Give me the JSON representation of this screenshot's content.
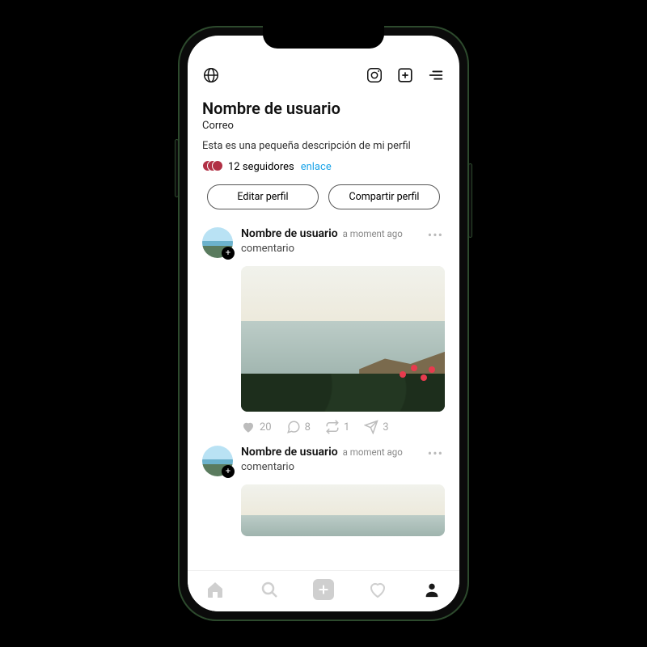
{
  "topbar": {
    "globe": "globe-icon",
    "instagram": "instagram-icon",
    "add": "add-icon",
    "menu": "menu-icon"
  },
  "profile": {
    "name": "Nombre de usuario",
    "email": "Correo",
    "bio": "Esta es una pequeña descripción de mi perfil",
    "followers_label": "12 seguidores",
    "link_label": "enlace"
  },
  "buttons": {
    "edit": "Editar perfil",
    "share": "Compartir perfil"
  },
  "posts": [
    {
      "author": "Nombre de usuario",
      "time": "a moment ago",
      "comment": "comentario",
      "likes": "20",
      "replies": "8",
      "reposts": "1",
      "sends": "3"
    },
    {
      "author": "Nombre de usuario",
      "time": "a moment ago",
      "comment": "comentario"
    }
  ]
}
